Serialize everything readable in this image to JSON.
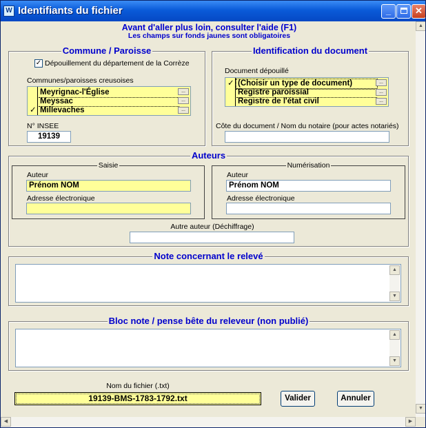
{
  "window": {
    "title": "Identifiants du fichier",
    "icon": "app-logo-icon"
  },
  "header": {
    "hint_line1": "Avant d'aller plus loin, consulter l'aide (F1)",
    "hint_line2": "Les champs sur fonds jaunes sont obligatoires"
  },
  "commune": {
    "title": "Commune / Paroisse",
    "checkbox_label": "Dépouillement du département de la Corrèze",
    "checkbox_checked": true,
    "list_label": "Communes/paroisses creusoises",
    "list_items": [
      {
        "label": "Meyrignac-l'Église",
        "checked": false
      },
      {
        "label": "Meyssac",
        "checked": false
      },
      {
        "label": "Millevaches",
        "checked": true
      }
    ],
    "insee_label": "N° INSEE",
    "insee_value": "19139"
  },
  "document": {
    "title": "Identification du document",
    "list_label": "Document dépouillé",
    "list_items": [
      {
        "label": "(Choisir un type de document)",
        "checked": true
      },
      {
        "label": "Registre paroissial",
        "checked": false
      },
      {
        "label": "Registre de l'état civil",
        "checked": false
      }
    ],
    "cote_label": "Côte du document / Nom du notaire (pour actes notariés)",
    "cote_value": ""
  },
  "auteurs": {
    "title": "Auteurs",
    "saisie": {
      "title": "Saisie",
      "author_label": "Auteur",
      "author_value": "Prénom NOM",
      "email_label": "Adresse électronique",
      "email_value": ""
    },
    "numerisation": {
      "title": "Numérisation",
      "author_label": "Auteur",
      "author_value": "Prénom NOM",
      "email_label": "Adresse électronique",
      "email_value": ""
    },
    "other_label": "Autre auteur (Déchiffrage)",
    "other_value": ""
  },
  "note": {
    "title": "Note concernant le relevé"
  },
  "bloc_note": {
    "title": "Bloc note / pense bête du releveur (non publié)"
  },
  "footer": {
    "filename_label": "Nom du fichier (.txt)",
    "filename_value": "19139-BMS-1783-1792.txt",
    "validate_label": "Valider",
    "cancel_label": "Annuler"
  },
  "glyphs": {
    "check": "✓",
    "up": "▲",
    "down": "▼",
    "left": "◀",
    "right": "▶",
    "dots": "...",
    "minimize": "_",
    "close": "✕"
  }
}
